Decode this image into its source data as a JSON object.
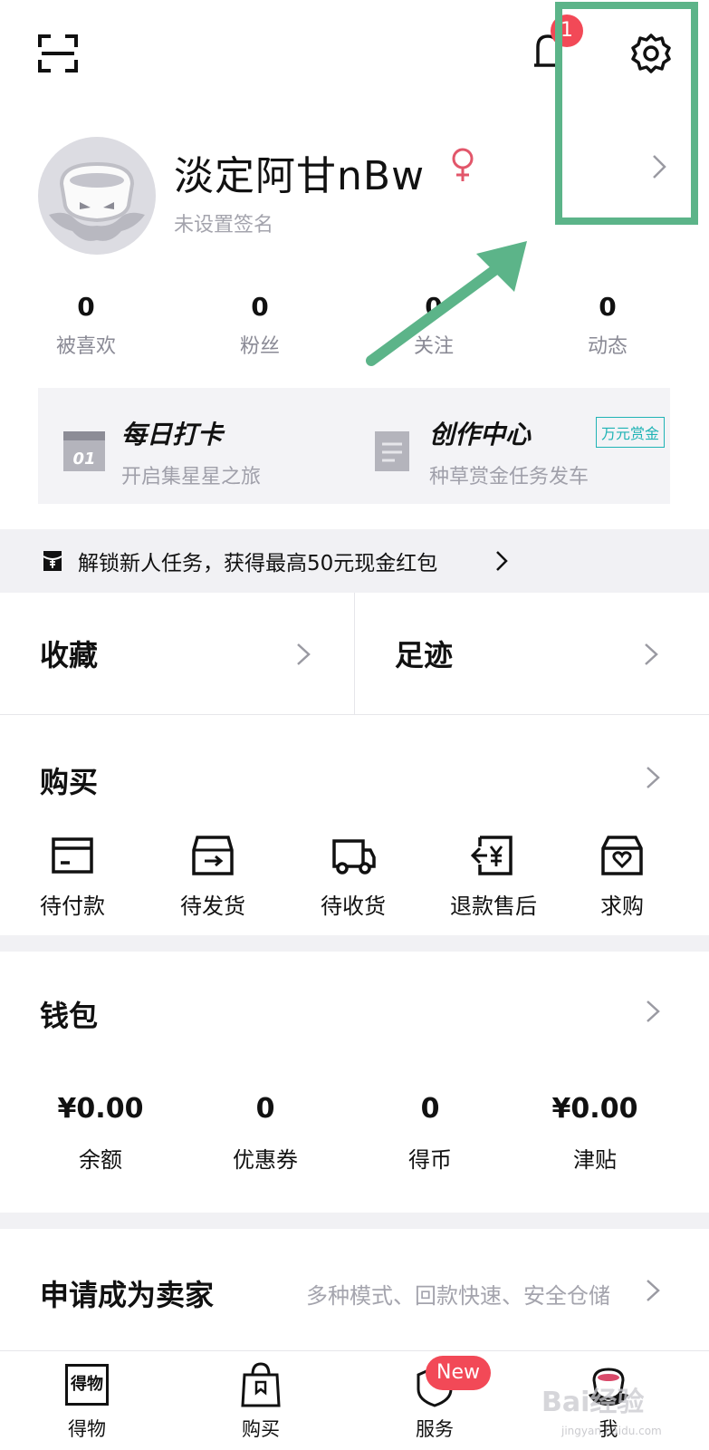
{
  "top_bar": {
    "notification_count": "1"
  },
  "profile": {
    "username": "淡定阿甘nBw",
    "gender_symbol": "♀",
    "signature": "未设置签名"
  },
  "stats": [
    {
      "value": "0",
      "label": "被喜欢"
    },
    {
      "value": "0",
      "label": "粉丝"
    },
    {
      "value": "0",
      "label": "关注"
    },
    {
      "value": "0",
      "label": "动态"
    }
  ],
  "cards": {
    "checkin": {
      "title": "每日打卡",
      "subtitle": "开启集星星之旅",
      "icon_text": "01"
    },
    "creator": {
      "title": "创作中心",
      "subtitle": "种草赏金任务发车",
      "tag": "万元赏金"
    }
  },
  "banner": {
    "text": "解锁新人任务，获得最高50元现金红包"
  },
  "quick_links": {
    "favorites": "收藏",
    "footprints": "足迹"
  },
  "purchase": {
    "title": "购买",
    "items": [
      {
        "label": "待付款",
        "icon": "card-icon"
      },
      {
        "label": "待发货",
        "icon": "box-icon"
      },
      {
        "label": "待收货",
        "icon": "truck-icon"
      },
      {
        "label": "退款售后",
        "icon": "refund-icon"
      },
      {
        "label": "求购",
        "icon": "wish-bag-icon"
      }
    ]
  },
  "wallet": {
    "title": "钱包",
    "items": [
      {
        "value": "¥0.00",
        "label": "余额"
      },
      {
        "value": "0",
        "label": "优惠券"
      },
      {
        "value": "0",
        "label": "得币"
      },
      {
        "value": "¥0.00",
        "label": "津贴"
      }
    ]
  },
  "seller": {
    "title": "申请成为卖家",
    "description": "多种模式、回款快速、安全仓储"
  },
  "tab_bar": {
    "tabs": [
      {
        "label": "得物",
        "icon_text": "得物"
      },
      {
        "label": "购买"
      },
      {
        "label": "服务"
      },
      {
        "label": "我"
      }
    ],
    "new_badge": "New"
  },
  "watermark": {
    "text": "Bai经验",
    "sub": "jingyan.baidu.com"
  },
  "colors": {
    "badge_red": "#f24957",
    "annotation_green": "#5cb489",
    "tag_teal": "#1fb3b5",
    "gender_pink": "#e2566a"
  }
}
